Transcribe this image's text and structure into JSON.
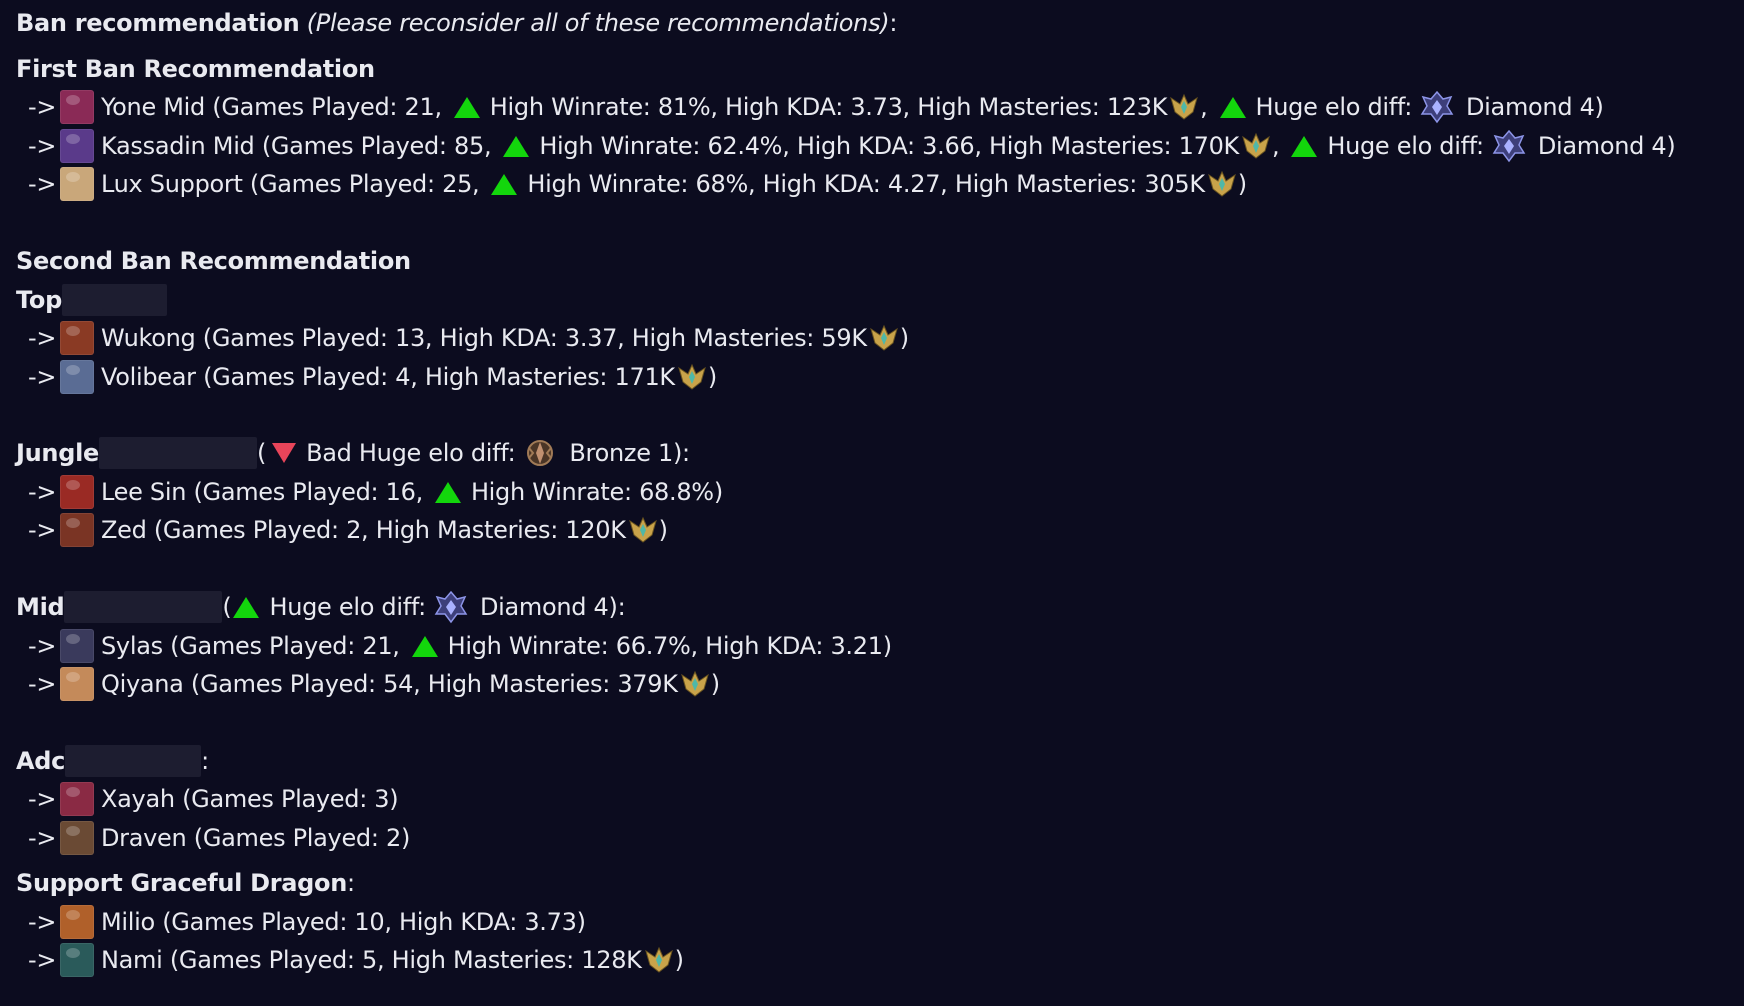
{
  "header": {
    "title": "Ban recommendation",
    "note": "(Please reconsider all of these recommendations)",
    "colon": " :"
  },
  "common": {
    "arrow": "->",
    "comma": ",",
    "close_paren": ")",
    "open_paren": "(",
    "colon": ":"
  },
  "first": {
    "heading": "First Ban Recommendation",
    "rows": [
      {
        "head": "Yone Mid (Games Played: 21,",
        "stats": "High Winrate: 81%, High KDA: 3.73, High Masteries: 123K",
        "elo": "Huge elo diff:",
        "rank": "Diamond 4)",
        "champ_color": "#8a2a56"
      },
      {
        "head": "Kassadin Mid (Games Played: 85,",
        "stats": "High Winrate: 62.4%, High KDA: 3.66, High Masteries: 170K",
        "elo": "Huge elo diff:",
        "rank": "Diamond 4)",
        "champ_color": "#5a3a8a"
      },
      {
        "head": "Lux Support (Games Played: 25,",
        "stats": "High Winrate: 68%, High KDA: 4.27, High Masteries: 305K",
        "end": ")",
        "champ_color": "#c9a77a"
      }
    ]
  },
  "second": {
    "heading": "Second Ban Recommendation",
    "top": {
      "label": "Top",
      "rows": [
        {
          "text": "Wukong (Games Played: 13, High KDA: 3.37, High Masteries: 59K",
          "end": ")",
          "champ_color": "#8a3a24"
        },
        {
          "text": "Volibear (Games Played: 4, High Masteries: 171K",
          "end": ")",
          "champ_color": "#5a6c94"
        }
      ]
    },
    "jungle": {
      "label": "Jungle",
      "bad": "Bad Huge elo diff:",
      "rank": "Bronze 1):",
      "rows": [
        {
          "head": "Lee Sin (Games Played: 16,",
          "stats": "High Winrate: 68.8%)",
          "champ_color": "#9a2a24"
        },
        {
          "text": "Zed (Games Played: 2, High Masteries: 120K",
          "end": ")",
          "champ_color": "#7a3424"
        }
      ]
    },
    "mid": {
      "label": "Mid",
      "elo": "Huge elo diff:",
      "rank": "Diamond 4):",
      "rows": [
        {
          "head": "Sylas (Games Played: 21,",
          "stats": "High Winrate: 66.7%, High KDA: 3.21)",
          "champ_color": "#3a3a5c"
        },
        {
          "text": "Qiyana (Games Played: 54, High Masteries: 379K",
          "end": ")",
          "champ_color": "#c48a5a"
        }
      ]
    },
    "adc": {
      "label": "Adc",
      "rows": [
        {
          "text": "Xayah (Games Played: 3)",
          "champ_color": "#8a2a44"
        },
        {
          "text": "Draven (Games Played: 2)",
          "champ_color": "#6a4a34"
        }
      ]
    },
    "support": {
      "label": "Support Graceful Dragon",
      "rows": [
        {
          "text": "Milio (Games Played: 10, High KDA: 3.73)",
          "champ_color": "#b0602a"
        },
        {
          "text": "Nami (Games Played: 5, High Masteries: 128K",
          "end": ")",
          "champ_color": "#2a5a5a"
        }
      ]
    }
  },
  "colors": {
    "up": "#13d60c",
    "down": "#e8455a",
    "background": "#0c0c1f",
    "text": "#e9eaf0",
    "mastery": "#c9a34a",
    "diamond": "#6c74c8",
    "bronze": "#8a6a4a"
  }
}
